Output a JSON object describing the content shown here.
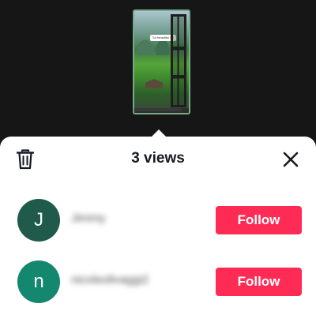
{
  "story": {
    "caption": "So beautiful 😍"
  },
  "sheet": {
    "title": "3 views",
    "delete_icon": "trash-icon",
    "close_icon": "close-icon"
  },
  "viewers": [
    {
      "initial": "J",
      "username": "Jimmy",
      "follow_label": "Follow",
      "avatar_color": "#1f5a4b"
    },
    {
      "initial": "n",
      "username": "nicoleolivaggi2",
      "follow_label": "Follow",
      "avatar_color": "#14876f"
    }
  ],
  "colors": {
    "accent": "#fe2c55",
    "background": "#161616",
    "sheet": "#ffffff"
  }
}
